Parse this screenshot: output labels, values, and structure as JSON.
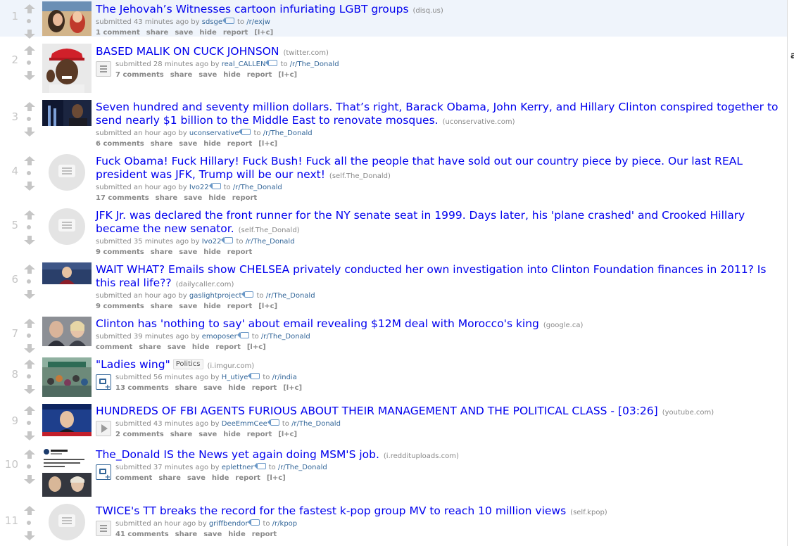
{
  "posts": [
    {
      "rank": "1",
      "title": "The Jehovah’s Witnesses cartoon infuriating LGBT groups",
      "domain": "(disq.us)",
      "submitted": "submitted 43 minutes ago by",
      "author": "sdsge",
      "to": "to",
      "subreddit": "/r/exjw",
      "comments": "1 comment",
      "share": "share",
      "save": "save",
      "hide": "hide",
      "report": "report",
      "extra": "[l+c]"
    },
    {
      "rank": "2",
      "title": "BASED MALIK ON CUCK JOHNSON",
      "domain": "(twitter.com)",
      "submitted": "submitted 28 minutes ago by",
      "author": "real_CALLEN",
      "to": "to",
      "subreddit": "/r/The_Donald",
      "comments": "7 comments",
      "share": "share",
      "save": "save",
      "hide": "hide",
      "report": "report",
      "extra": "[l+c]"
    },
    {
      "rank": "3",
      "title": "Seven hundred and seventy million dollars. That’s right, Barack Obama, John Kerry, and Hillary Clinton conspired together to send nearly $1 billion to the Middle East to renovate mosques.",
      "domain": "(uconservative.com)",
      "submitted": "submitted an hour ago by",
      "author": "uconservative",
      "to": "to",
      "subreddit": "/r/The_Donald",
      "comments": "6 comments",
      "share": "share",
      "save": "save",
      "hide": "hide",
      "report": "report",
      "extra": "[l+c]"
    },
    {
      "rank": "4",
      "title": "Fuck Obama! Fuck Hillary! Fuck Bush! Fuck all the people that have sold out our country piece by piece. Our last REAL president was JFK, Trump will be our next!",
      "domain": "(self.The_Donald)",
      "submitted": "submitted an hour ago by",
      "author": "Ivo22",
      "to": "to",
      "subreddit": "/r/The_Donald",
      "comments": "17 comments",
      "share": "share",
      "save": "save",
      "hide": "hide",
      "report": "report",
      "extra": ""
    },
    {
      "rank": "5",
      "title": "JFK Jr. was declared the front runner for the NY senate seat in 1999. Days later, his 'plane crashed' and Crooked Hillary became the new senator.",
      "domain": "(self.The_Donald)",
      "submitted": "submitted 35 minutes ago by",
      "author": "Ivo22",
      "to": "to",
      "subreddit": "/r/The_Donald",
      "comments": "9 comments",
      "share": "share",
      "save": "save",
      "hide": "hide",
      "report": "report",
      "extra": ""
    },
    {
      "rank": "6",
      "title": "WAIT WHAT? Emails show CHELSEA privately conducted her own investigation into Clinton Foundation finances in 2011? Is this real life??",
      "domain": "(dailycaller.com)",
      "submitted": "submitted an hour ago by",
      "author": "gaslightproject",
      "to": "to",
      "subreddit": "/r/The_Donald",
      "comments": "9 comments",
      "share": "share",
      "save": "save",
      "hide": "hide",
      "report": "report",
      "extra": "[l+c]"
    },
    {
      "rank": "7",
      "title": "Clinton has 'nothing to say' about email revealing $12M deal with Morocco's king",
      "domain": "(google.ca)",
      "submitted": "submitted 39 minutes ago by",
      "author": "emoposer",
      "to": "to",
      "subreddit": "/r/The_Donald",
      "comments": "comment",
      "share": "share",
      "save": "save",
      "hide": "hide",
      "report": "report",
      "extra": "[l+c]"
    },
    {
      "rank": "8",
      "title": "\"Ladies wing\"",
      "flair": "Politics",
      "domain": "(i.imgur.com)",
      "submitted": "submitted 56 minutes ago by",
      "author": "H_utiye",
      "to": "to",
      "subreddit": "/r/india",
      "comments": "13 comments",
      "share": "share",
      "save": "save",
      "hide": "hide",
      "report": "report",
      "extra": "[l+c]"
    },
    {
      "rank": "9",
      "title": "HUNDREDS OF FBI AGENTS FURIOUS ABOUT THEIR MANAGEMENT AND THE POLITICAL CLASS - [03:26]",
      "domain": "(youtube.com)",
      "submitted": "submitted 43 minutes ago by",
      "author": "DeeEmmCee",
      "to": "to",
      "subreddit": "/r/The_Donald",
      "comments": "2 comments",
      "share": "share",
      "save": "save",
      "hide": "hide",
      "report": "report",
      "extra": "[l+c]"
    },
    {
      "rank": "10",
      "title": "The_Donald IS the News yet again doing MSM'S job.",
      "domain": "(i.reddituploads.com)",
      "submitted": "submitted 37 minutes ago by",
      "author": "eplettner",
      "to": "to",
      "subreddit": "/r/The_Donald",
      "comments": "comment",
      "share": "share",
      "save": "save",
      "hide": "hide",
      "report": "report",
      "extra": "[l+c]"
    },
    {
      "rank": "11",
      "title": "TWICE's TT breaks the record for the fastest k-pop group MV to reach 10 million views",
      "domain": "(self.kpop)",
      "submitted": "submitted an hour ago by",
      "author": "griffbendor",
      "to": "to",
      "subreddit": "/r/kpop",
      "comments": "41 comments",
      "share": "share",
      "save": "save",
      "hide": "hide",
      "report": "report",
      "extra": ""
    }
  ],
  "sidebar_fragment": "a"
}
